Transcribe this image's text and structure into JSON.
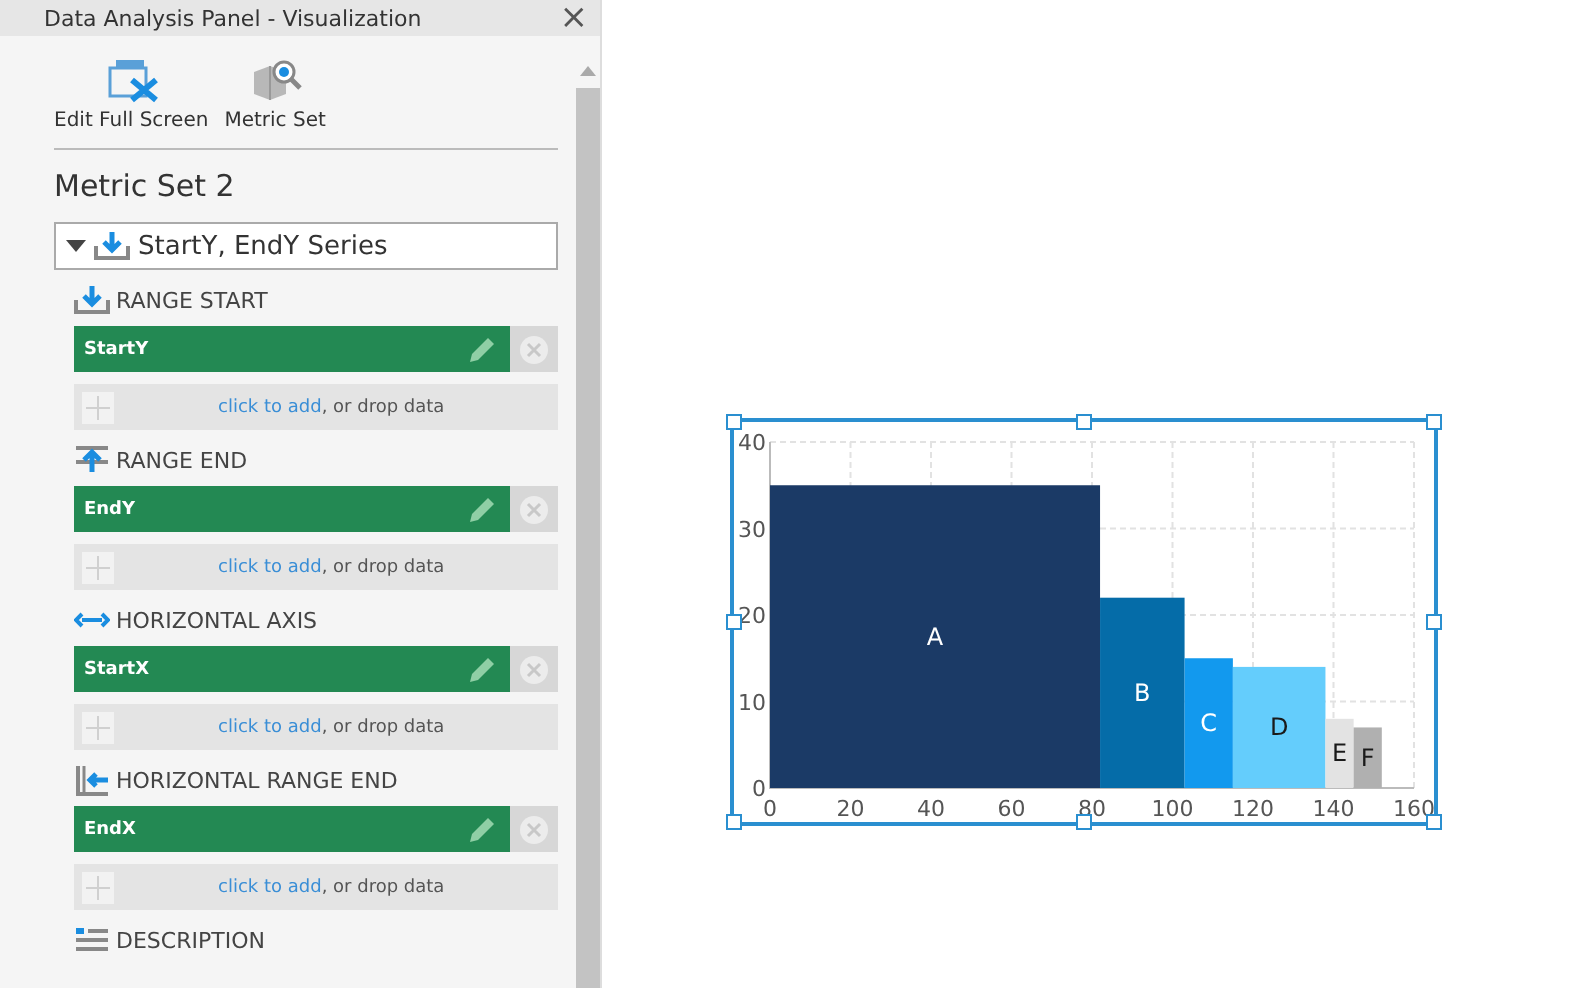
{
  "panel": {
    "title": "Data Analysis Panel - Visualization",
    "close": "×",
    "toolbar": [
      {
        "kind": "fullscreen",
        "label": "Edit Full Screen"
      },
      {
        "kind": "metric",
        "label": "Metric Set"
      }
    ],
    "metric_set": "Metric Set 2",
    "series": {
      "label": "StartY, EndY Series",
      "expanded": true
    },
    "groups": [
      {
        "kind": "start",
        "title": "RANGE START",
        "field": "StartY",
        "add_link": "click to add",
        "add_text": ", or drop data"
      },
      {
        "kind": "end",
        "title": "RANGE END",
        "field": "EndY",
        "add_link": "click to add",
        "add_text": ", or drop data"
      },
      {
        "kind": "axis",
        "title": "HORIZONTAL AXIS",
        "field": "StartX",
        "add_link": "click to add",
        "add_text": ", or drop data"
      },
      {
        "kind": "hend",
        "title": "HORIZONTAL RANGE END",
        "field": "EndX",
        "add_link": "click to add",
        "add_text": ", or drop data"
      },
      {
        "kind": "desc",
        "title": "DESCRIPTION"
      }
    ]
  },
  "visualization": {
    "chart_data": {
      "type": "bar",
      "x": [
        41,
        92.5,
        109,
        126.5,
        141.5,
        148.5
      ],
      "series": [
        {
          "name": "A",
          "color": "#1b3a66",
          "values": [
            35,
            null,
            null,
            null,
            null,
            null
          ]
        },
        {
          "name": "B",
          "color": "#056ca8",
          "values": [
            null,
            22,
            null,
            null,
            null,
            null
          ]
        },
        {
          "name": "C",
          "color": "#1299ee",
          "values": [
            null,
            null,
            15,
            null,
            null,
            null
          ]
        },
        {
          "name": "D",
          "color": "#64cdfc",
          "values": [
            null,
            null,
            null,
            14,
            null,
            null
          ]
        },
        {
          "name": "E",
          "color": "#e3e3e3",
          "values": [
            null,
            null,
            null,
            null,
            8,
            null
          ]
        },
        {
          "name": "F",
          "color": "#b0b0b0",
          "values": [
            null,
            null,
            null,
            null,
            null,
            7
          ]
        }
      ],
      "xlim": [
        0,
        160
      ],
      "ylim": [
        0,
        40
      ],
      "xticks": [
        0,
        20,
        40,
        60,
        80,
        100,
        120,
        140,
        160
      ],
      "yticks": [
        0,
        10,
        20,
        30,
        40
      ],
      "grid": true
    }
  }
}
